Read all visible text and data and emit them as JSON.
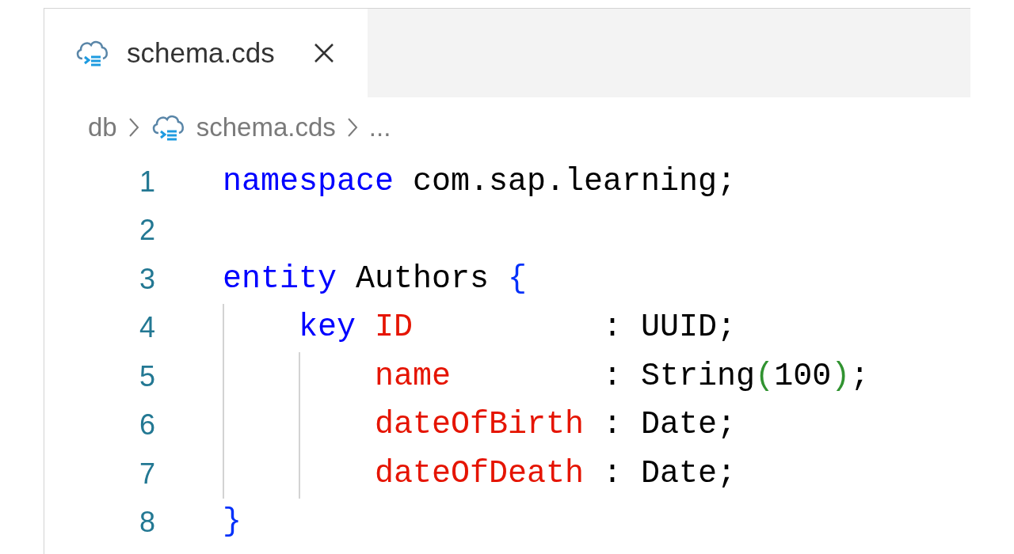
{
  "tabs": [
    {
      "label": "schema.cds",
      "selected": true
    }
  ],
  "breadcrumbs": [
    {
      "kind": "folder",
      "label": "db"
    },
    {
      "kind": "file",
      "label": "schema.cds"
    },
    {
      "kind": "more",
      "label": "..."
    }
  ],
  "code": [
    {
      "number": "1",
      "tokens": [
        {
          "kind": "keyword",
          "text": "namespace"
        },
        {
          "kind": "plain",
          "text": " com.sap.learning;"
        }
      ]
    },
    {
      "number": "2"
    },
    {
      "number": "3",
      "tokens": [
        {
          "kind": "keyword",
          "text": "entity"
        },
        {
          "kind": "plain",
          "text": " Authors "
        },
        {
          "kind": "brace",
          "text": "{"
        }
      ]
    },
    {
      "number": "4",
      "tokens": [
        {
          "kind": "keyword",
          "text": "    key"
        },
        {
          "kind": "field",
          "text": " ID"
        },
        {
          "kind": "plain",
          "text": "          : UUID;"
        }
      ]
    },
    {
      "number": "5",
      "tokens": [
        {
          "kind": "field",
          "text": "        name"
        },
        {
          "kind": "plain",
          "text": "        : String"
        },
        {
          "kind": "paren",
          "text": "("
        },
        {
          "kind": "plain",
          "text": "100"
        },
        {
          "kind": "paren",
          "text": ")"
        },
        {
          "kind": "plain",
          "text": ";"
        }
      ]
    },
    {
      "number": "6",
      "tokens": [
        {
          "kind": "field",
          "text": "        dateOfBirth"
        },
        {
          "kind": "plain",
          "text": " : Date;"
        }
      ]
    },
    {
      "number": "7",
      "tokens": [
        {
          "kind": "field",
          "text": "        dateOfDeath"
        },
        {
          "kind": "plain",
          "text": " : Date;"
        }
      ]
    },
    {
      "number": "8",
      "tokens": [
        {
          "kind": "brace",
          "text": "}"
        }
      ]
    }
  ]
}
